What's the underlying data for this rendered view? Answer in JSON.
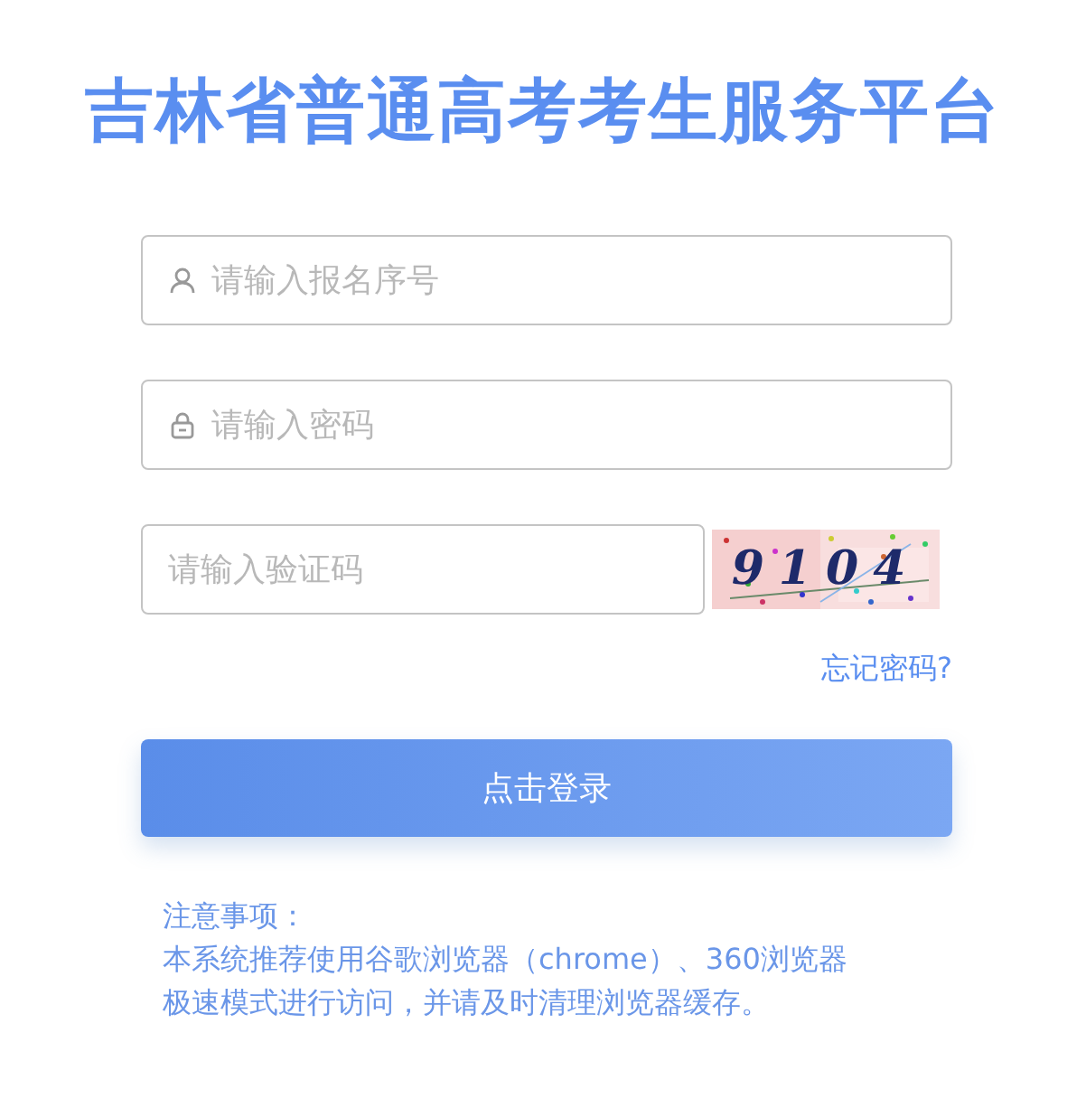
{
  "title": "吉林省普通高考考生服务平台",
  "fields": [
    {
      "kind": "user",
      "placeholder": "请输入报名序号"
    },
    {
      "kind": "lock",
      "placeholder": "请输入密码"
    },
    {
      "kind": "captcha",
      "placeholder": "请输入验证码",
      "captcha": "9104"
    }
  ],
  "forgot_link": "忘记密码?",
  "login_button": "点击登录",
  "notes": {
    "title": "注意事项：",
    "lines": [
      "本系统推荐使用谷歌浏览器（chrome）、360浏览器",
      "极速模式进行访问，并请及时清理浏览器缓存。"
    ]
  }
}
